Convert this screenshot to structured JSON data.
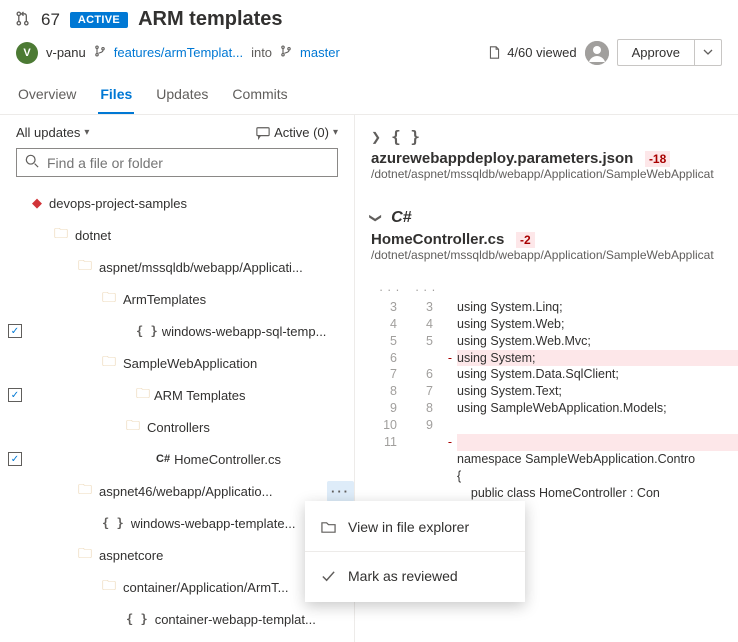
{
  "pr": {
    "number": "67",
    "status": "ACTIVE",
    "title": "ARM templates"
  },
  "user": {
    "initial": "V",
    "name": "v-panu"
  },
  "branch": {
    "source": "features/armTemplat...",
    "into": "into",
    "target": "master"
  },
  "progress": {
    "label": "4/60 viewed"
  },
  "approve": {
    "label": "Approve"
  },
  "tabs": [
    "Overview",
    "Files",
    "Updates",
    "Commits"
  ],
  "filter": {
    "updates": "All updates",
    "comments": "Active (0)"
  },
  "search": {
    "placeholder": "Find a file or folder"
  },
  "tree": {
    "root": "devops-project-samples",
    "dotnet": "dotnet",
    "p1": "aspnet/mssqldb/webapp/Applicati...",
    "arm1": "ArmTemplates",
    "f1": "windows-webapp-sql-temp...",
    "sample": "SampleWebApplication",
    "arm2": "ARM Templates",
    "ctrl": "Controllers",
    "hc": "HomeController.cs",
    "p2": "aspnet46/webapp/Applicatio...",
    "f2": "windows-webapp-template...",
    "core": "aspnetcore",
    "p3": "container/Application/ArmT...",
    "f3": "container-webapp-templat..."
  },
  "file1": {
    "name": "azurewebappdeploy.parameters.json",
    "diff": "-18",
    "path": "/dotnet/aspnet/mssqldb/webapp/Application/SampleWebApplicat"
  },
  "file2": {
    "lang": "C#",
    "name": "HomeController.cs",
    "diff": "-2",
    "path": "/dotnet/aspnet/mssqldb/webapp/Application/SampleWebApplicat"
  },
  "code": {
    "l3a": "3",
    "l3b": "3",
    "c3": "using System.Linq;",
    "l4a": "4",
    "l4b": "4",
    "c4": "using System.Web;",
    "l5a": "5",
    "l5b": "5",
    "c5": "using System.Web.Mvc;",
    "l6a": "6",
    "c6": "using System;",
    "l7a": "7",
    "l7b": "6",
    "c7": "using System.Data.SqlClient;",
    "l8a": "8",
    "l8b": "7",
    "c8": "using System.Text;",
    "l9a": "9",
    "l9b": "8",
    "c9": "using SampleWebApplication.Models;",
    "l10a": "10",
    "l10b": "9",
    "l11a": "11",
    "c12": "namespace SampleWebApplication.Contro",
    "c13": "{",
    "c14": "    public class HomeController : Con"
  },
  "menu": {
    "view": "View in file explorer",
    "mark": "Mark as reviewed"
  }
}
